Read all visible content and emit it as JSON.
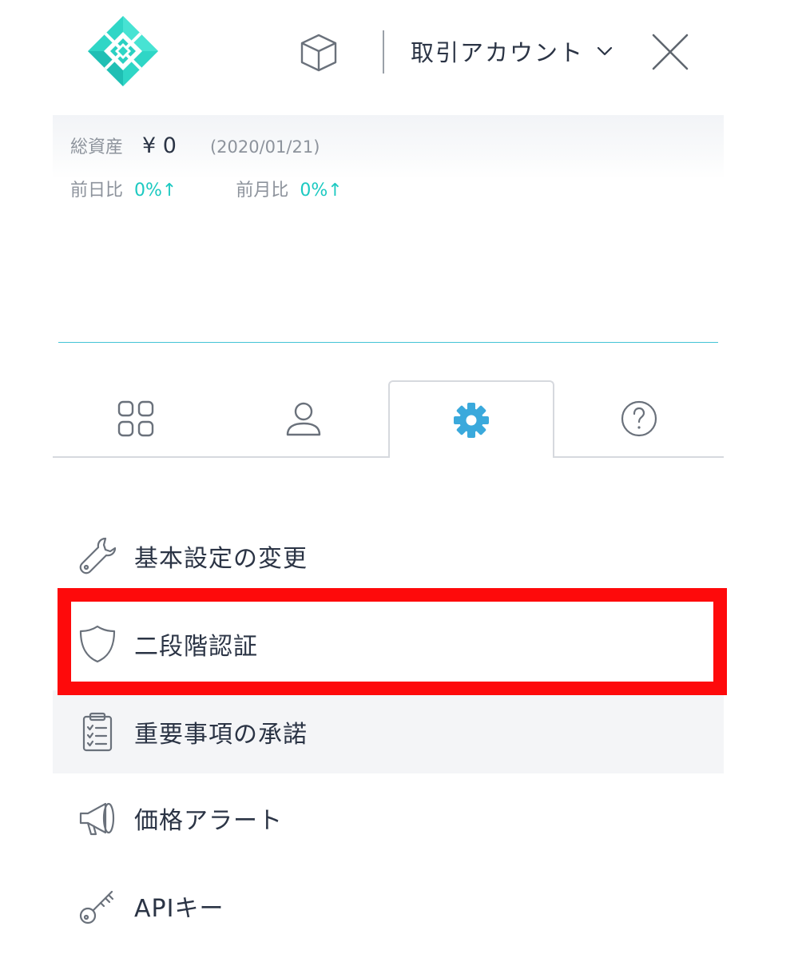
{
  "header": {
    "logo_icon": "diamond-logo-icon",
    "cube_icon": "cube-icon",
    "account_label": "取引アカウント",
    "chevron_icon": "chevron-down-icon",
    "close_icon": "close-icon"
  },
  "assets": {
    "total_label": "総資産",
    "total_value": "¥ 0",
    "date": "(2020/01/21)",
    "day_change_label": "前日比",
    "day_change_value": "0%↑",
    "month_change_label": "前月比",
    "month_change_value": "0%↑"
  },
  "tabs": [
    {
      "name": "dashboard",
      "icon": "grid-icon",
      "active": false
    },
    {
      "name": "account",
      "icon": "user-icon",
      "active": false
    },
    {
      "name": "settings",
      "icon": "gear-icon",
      "active": true
    },
    {
      "name": "help",
      "icon": "help-icon",
      "active": false
    }
  ],
  "menu": {
    "items": [
      {
        "label": "基本設定の変更",
        "icon": "wrench-icon"
      },
      {
        "label": "二段階認証",
        "icon": "shield-icon"
      },
      {
        "label": "重要事項の承諾",
        "icon": "clipboard-checklist-icon"
      },
      {
        "label": "価格アラート",
        "icon": "megaphone-icon"
      },
      {
        "label": "APIキー",
        "icon": "key-icon"
      }
    ]
  },
  "colors": {
    "accent_teal": "#1cc9c1",
    "gear_blue": "#3aa9dc",
    "highlight_red": "#fe0a0b",
    "text_dark": "#2b3445",
    "text_muted": "#8d939c"
  }
}
